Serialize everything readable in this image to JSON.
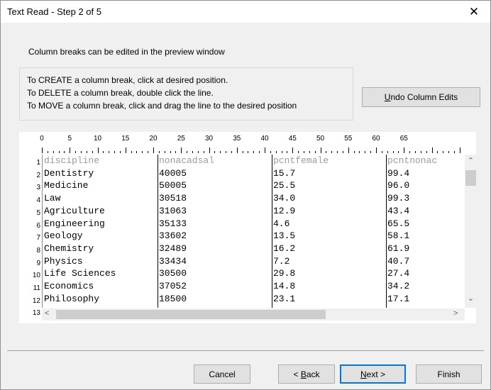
{
  "window": {
    "title": "Text Read - Step 2 of 5",
    "close_label": "✕"
  },
  "instruction": "Column breaks can be edited in the preview window",
  "help_lines": [
    "To CREATE a column break, click at desired position.",
    "To DELETE a column break, double click the line.",
    "To MOVE a column break, click and drag the line to the desired position"
  ],
  "undo_button": {
    "u": "U",
    "rest": "ndo Column Edits"
  },
  "ruler_labels": [
    "0",
    "5",
    "10",
    "15",
    "20",
    "25",
    "30",
    "35",
    "40",
    "45",
    "50",
    "55",
    "60",
    "65"
  ],
  "row_numbers": [
    "1",
    "2",
    "3",
    "4",
    "5",
    "6",
    "7",
    "8",
    "9",
    "10",
    "11",
    "12",
    "13"
  ],
  "header_row": [
    "discipline",
    "nonacadsal",
    "pcntfemale",
    "pcntnonac"
  ],
  "rows": [
    [
      "Dentistry",
      "40005",
      "15.7",
      "99.4"
    ],
    [
      "Medicine",
      "50005",
      "25.5",
      "96.0"
    ],
    [
      "Law",
      "30518",
      "34.0",
      "99.3"
    ],
    [
      "Agriculture",
      "31063",
      "12.9",
      "43.4"
    ],
    [
      "Engineering",
      "35133",
      "4.6",
      "65.5"
    ],
    [
      "Geology",
      "33602",
      "13.5",
      "58.1"
    ],
    [
      "Chemistry",
      "32489",
      "16.2",
      "61.9"
    ],
    [
      "Physics",
      "33434",
      "7.2",
      "40.7"
    ],
    [
      "Life Sciences",
      "30500",
      "29.8",
      "27.4"
    ],
    [
      "Economics",
      "37052",
      "14.8",
      "34.2"
    ],
    [
      "Philosophy",
      "18500",
      "23.1",
      "17.1"
    ]
  ],
  "buttons": {
    "cancel": "Cancel",
    "back": {
      "pre": "< ",
      "u": "B",
      "rest": "ack"
    },
    "next": {
      "u": "N",
      "rest": "ext >"
    },
    "finish": "Finish"
  },
  "scroll_arrows": {
    "up": "⌃",
    "down": "⌄",
    "left": "<",
    "right": ">"
  }
}
